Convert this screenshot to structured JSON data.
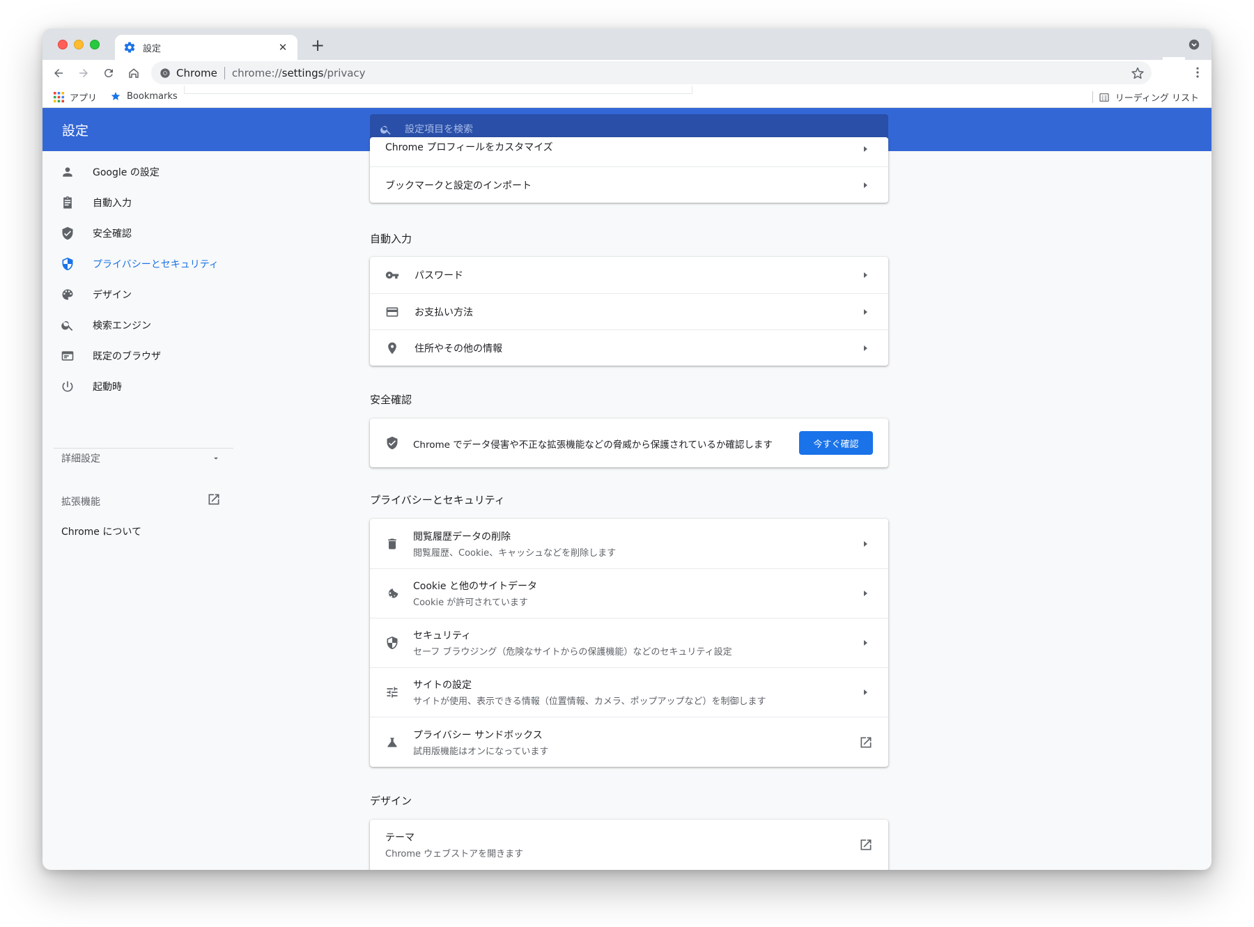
{
  "browser": {
    "tab_title": "設定",
    "omnibox_site": "Chrome",
    "omnibox_url_prefix": "chrome://",
    "omnibox_url_host": "settings",
    "omnibox_url_path": "/privacy",
    "bookmarks_apps": "アプリ",
    "bookmarks_bookmarks": "Bookmarks",
    "reading_list": "リーディング リスト"
  },
  "header": {
    "title": "設定",
    "search_placeholder": "設定項目を検索"
  },
  "sidebar": {
    "items": [
      {
        "label": "Google の設定"
      },
      {
        "label": "自動入力"
      },
      {
        "label": "安全確認"
      },
      {
        "label": "プライバシーとセキュリティ"
      },
      {
        "label": "デザイン"
      },
      {
        "label": "検索エンジン"
      },
      {
        "label": "既定のブラウザ"
      },
      {
        "label": "起動時"
      }
    ],
    "advanced": "詳細設定",
    "extensions": "拡張機能",
    "about": "Chrome について"
  },
  "main": {
    "cut_row_label": "Chrome プロフィールをカスタマイズ",
    "import_label": "ブックマークと設定のインポート",
    "autofill": {
      "title": "自動入力",
      "rows": [
        {
          "label": "パスワード"
        },
        {
          "label": "お支払い方法"
        },
        {
          "label": "住所やその他の情報"
        }
      ]
    },
    "safety": {
      "title": "安全確認",
      "text": "Chrome でデータ侵害や不正な拡張機能などの脅威から保護されているか確認します",
      "button": "今すぐ確認"
    },
    "privacy": {
      "title": "プライバシーとセキュリティ",
      "rows": [
        {
          "label": "閲覧履歴データの削除",
          "sub": "閲覧履歴、Cookie、キャッシュなどを削除します"
        },
        {
          "label": "Cookie と他のサイトデータ",
          "sub": "Cookie が許可されています"
        },
        {
          "label": "セキュリティ",
          "sub": "セーフ ブラウジング（危険なサイトからの保護機能）などのセキュリティ設定"
        },
        {
          "label": "サイトの設定",
          "sub": "サイトが使用、表示できる情報（位置情報、カメラ、ポップアップなど）を制御します"
        },
        {
          "label": "プライバシー サンドボックス",
          "sub": "試用版機能はオンになっています"
        }
      ]
    },
    "design": {
      "title": "デザイン",
      "theme_label": "テーマ",
      "theme_sub": "Chrome ウェブストアを開きます"
    }
  },
  "colors": {
    "header_blue": "#3367d6",
    "search_blue": "#294fa8",
    "accent": "#1a73e8"
  }
}
